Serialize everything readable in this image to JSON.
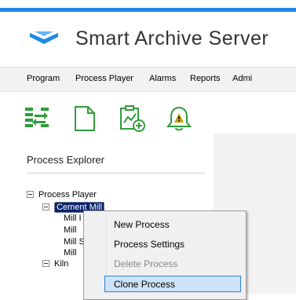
{
  "app": {
    "title": "Smart Archive Server"
  },
  "menubar": {
    "items": [
      {
        "label": "Program"
      },
      {
        "label": "Process Player"
      },
      {
        "label": "Alarms"
      },
      {
        "label": "Reports"
      },
      {
        "label": "Admi"
      }
    ]
  },
  "toolbar": {
    "buttons": [
      {
        "icon": "import-export-icon"
      },
      {
        "icon": "new-document-icon"
      },
      {
        "icon": "add-chart-clipboard-icon"
      },
      {
        "icon": "alarm-bell-icon"
      }
    ]
  },
  "explorer": {
    "title": "Process Explorer",
    "tree": {
      "root": "Process Player",
      "cement_mill": "Cement Mill",
      "mill_children": [
        "Mill I",
        "Mill",
        "Mill S",
        "Mill"
      ],
      "kiln": "Kiln"
    }
  },
  "context_menu": {
    "items": [
      {
        "label": "New Process",
        "enabled": true
      },
      {
        "label": "Process Settings",
        "enabled": true
      },
      {
        "label": "Delete Process",
        "enabled": false
      },
      {
        "label": "Clone Process",
        "enabled": true,
        "highlighted": true
      }
    ]
  },
  "colors": {
    "accent": "#1e88e5",
    "icon_green": "#2e9d3a",
    "icon_gold": "#c9a400",
    "selection": "#0a246a",
    "hover": "#cde3f7"
  }
}
